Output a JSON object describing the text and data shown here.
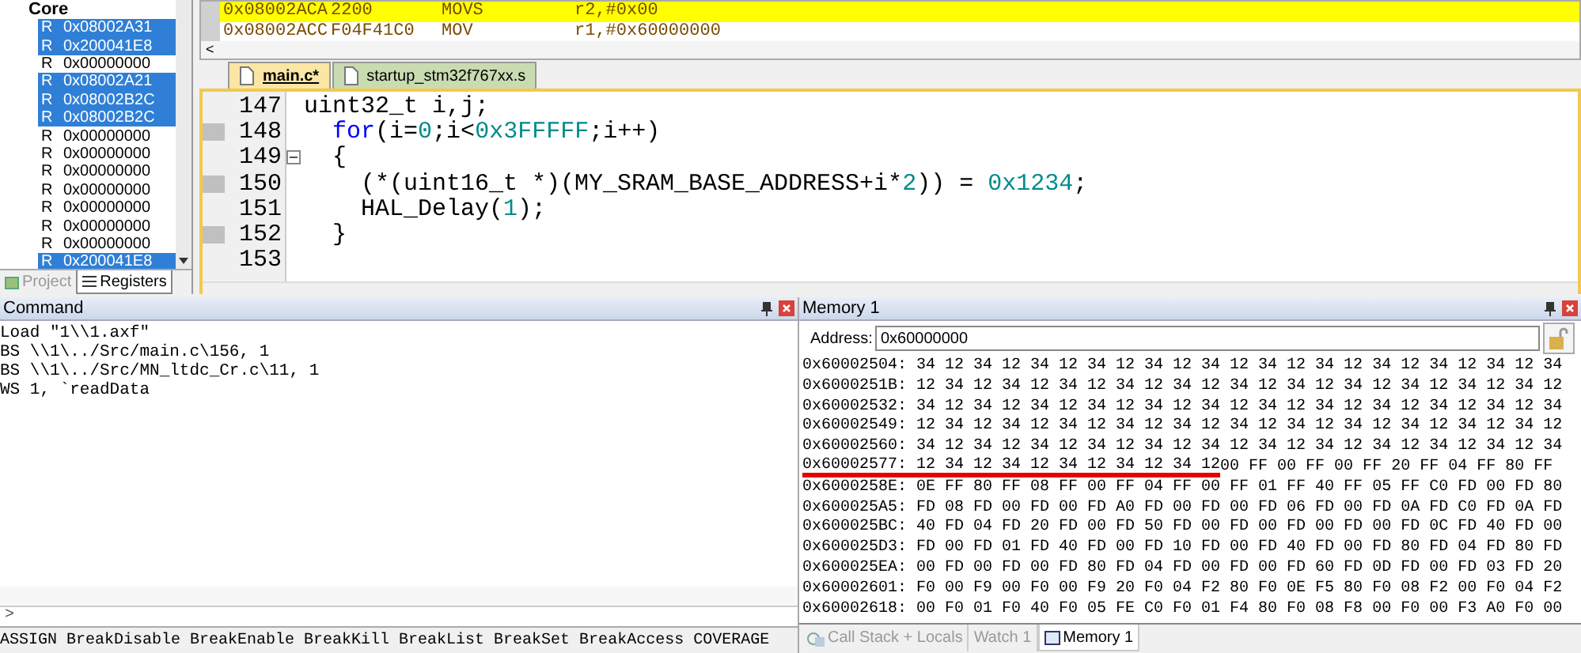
{
  "registers": {
    "group": "Core",
    "rows": [
      {
        "label": "R",
        "value": "0x08002A31",
        "selected": true
      },
      {
        "label": "R",
        "value": "0x200041E8",
        "selected": true
      },
      {
        "label": "R",
        "value": "0x00000000",
        "selected": false
      },
      {
        "label": "R",
        "value": "0x08002A21",
        "selected": true
      },
      {
        "label": "R",
        "value": "0x08002B2C",
        "selected": true
      },
      {
        "label": "R",
        "value": "0x08002B2C",
        "selected": true
      },
      {
        "label": "R",
        "value": "0x00000000",
        "selected": false
      },
      {
        "label": "R",
        "value": "0x00000000",
        "selected": false
      },
      {
        "label": "R",
        "value": "0x00000000",
        "selected": false
      },
      {
        "label": "R",
        "value": "0x00000000",
        "selected": false
      },
      {
        "label": "R",
        "value": "0x00000000",
        "selected": false
      },
      {
        "label": "R",
        "value": "0x00000000",
        "selected": false
      },
      {
        "label": "R",
        "value": "0x00000000",
        "selected": false
      },
      {
        "label": "R",
        "value": "0x200041E8",
        "selected": true
      }
    ],
    "tabs": [
      {
        "label": "Project",
        "selected": false
      },
      {
        "label": "Registers",
        "selected": true
      }
    ]
  },
  "disassembly": {
    "lines": [
      {
        "address": "0x08002ACA",
        "opcode": "2200",
        "mnemonic": "MOVS",
        "operands": "r2,#0x00",
        "current": true
      },
      {
        "address": "0x08002ACC",
        "opcode": "F04F41C0",
        "mnemonic": "MOV",
        "operands": "r1,#0x60000000",
        "current": false
      }
    ],
    "scroll_left": "<"
  },
  "editor": {
    "tabs": [
      {
        "label": "main.c*",
        "selected": true
      },
      {
        "label": "startup_stm32f767xx.s",
        "selected": false
      }
    ],
    "lines": [
      {
        "number": "147",
        "executable": false,
        "fold": false,
        "tokens": [
          {
            "kind": "plain",
            "text": "uint32_t i,j;"
          }
        ]
      },
      {
        "number": "148",
        "executable": true,
        "fold": false,
        "tokens": [
          {
            "kind": "keyword",
            "text": "  for"
          },
          {
            "kind": "plain",
            "text": "(i="
          },
          {
            "kind": "number",
            "text": "0"
          },
          {
            "kind": "plain",
            "text": ";i<"
          },
          {
            "kind": "number",
            "text": "0x3FFFFF"
          },
          {
            "kind": "plain",
            "text": ";i++)"
          }
        ]
      },
      {
        "number": "149",
        "executable": false,
        "fold": true,
        "tokens": [
          {
            "kind": "plain",
            "text": "  {"
          }
        ]
      },
      {
        "number": "150",
        "executable": true,
        "fold": false,
        "tokens": [
          {
            "kind": "plain",
            "text": "    (*(uint16_t *)(MY_SRAM_BASE_ADDRESS+i*"
          },
          {
            "kind": "number",
            "text": "2"
          },
          {
            "kind": "plain",
            "text": ")) = "
          },
          {
            "kind": "number",
            "text": "0x1234"
          },
          {
            "kind": "plain",
            "text": ";"
          }
        ]
      },
      {
        "number": "151",
        "executable": false,
        "fold": false,
        "tokens": [
          {
            "kind": "plain",
            "text": "    HAL_Delay("
          },
          {
            "kind": "number",
            "text": "1"
          },
          {
            "kind": "plain",
            "text": ");"
          }
        ]
      },
      {
        "number": "152",
        "executable": true,
        "fold": false,
        "tokens": [
          {
            "kind": "plain",
            "text": "  }"
          }
        ]
      },
      {
        "number": "153",
        "executable": false,
        "fold": false
      }
    ]
  },
  "command": {
    "title": "Command",
    "lines": [
      "Load \"1\\\\1.axf\"",
      "BS \\\\1\\../Src/main.c\\156, 1",
      "BS \\\\1\\../Src/MN_ltdc_Cr.c\\11, 1",
      "WS 1, `readData"
    ],
    "prompt": ">",
    "keywords": "ASSIGN BreakDisable BreakEnable BreakKill BreakList BreakSet BreakAccess COVERAGE"
  },
  "memory": {
    "title": "Memory 1",
    "address_label": "Address:",
    "address": "0x60000000",
    "rows": [
      {
        "address": "0x60002504:",
        "marked": "",
        "bytes": "34 12 34 12 34 12 34 12 34 12 34 12 34 12 34 12 34 12 34 12 34 12 34"
      },
      {
        "address": "0x6000251B:",
        "marked": "",
        "bytes": "12 34 12 34 12 34 12 34 12 34 12 34 12 34 12 34 12 34 12 34 12 34 12"
      },
      {
        "address": "0x60002532:",
        "marked": "",
        "bytes": "34 12 34 12 34 12 34 12 34 12 34 12 34 12 34 12 34 12 34 12 34 12 34"
      },
      {
        "address": "0x60002549:",
        "marked": "",
        "bytes": "12 34 12 34 12 34 12 34 12 34 12 34 12 34 12 34 12 34 12 34 12 34 12"
      },
      {
        "address": "0x60002560:",
        "marked": "",
        "bytes": "34 12 34 12 34 12 34 12 34 12 34 12 34 12 34 12 34 12 34 12 34 12 34"
      },
      {
        "address": "0x60002577:",
        "marked": "12 34 12 34 12 34 12 34 12 34 12",
        "bytes": "00 FF 00 FF 00 FF 20 FF 04 FF 80 FF"
      },
      {
        "address": "0x6000258E:",
        "marked": "",
        "bytes": "0E FF 80 FF 08 FF 00 FF 04 FF 00 FF 01 FF 40 FF 05 FF C0 FD 00 FD 80"
      },
      {
        "address": "0x600025A5:",
        "marked": "",
        "bytes": "FD 08 FD 00 FD 00 FD A0 FD 00 FD 00 FD 06 FD 00 FD 0A FD C0 FD 0A FD"
      },
      {
        "address": "0x600025BC:",
        "marked": "",
        "bytes": "40 FD 04 FD 20 FD 00 FD 50 FD 00 FD 00 FD 00 FD 00 FD 0C FD 40 FD 00"
      },
      {
        "address": "0x600025D3:",
        "marked": "",
        "bytes": "FD 00 FD 01 FD 40 FD 00 FD 10 FD 00 FD 40 FD 00 FD 80 FD 04 FD 80 FD"
      },
      {
        "address": "0x600025EA:",
        "marked": "",
        "bytes": "00 FD 00 FD 00 FD 80 FD 04 FD 00 FD 00 FD 60 FD 0D FD 00 FD 03 FD 20"
      },
      {
        "address": "0x60002601:",
        "marked": "",
        "bytes": "F0 00 F9 00 F0 00 F9 20 F0 04 F2 80 F0 0E F5 80 F0 08 F2 00 F0 04 F2"
      },
      {
        "address": "0x60002618:",
        "marked": "",
        "bytes": "00 F0 01 F0 40 F0 05 FE C0 F0 01 F4 80 F0 08 F8 00 F0 00 F3 A0 F0 00"
      }
    ],
    "tabs": [
      {
        "label": "Call Stack + Locals",
        "selected": false
      },
      {
        "label": "Watch 1",
        "selected": false
      },
      {
        "label": "Memory 1",
        "selected": true
      }
    ]
  }
}
